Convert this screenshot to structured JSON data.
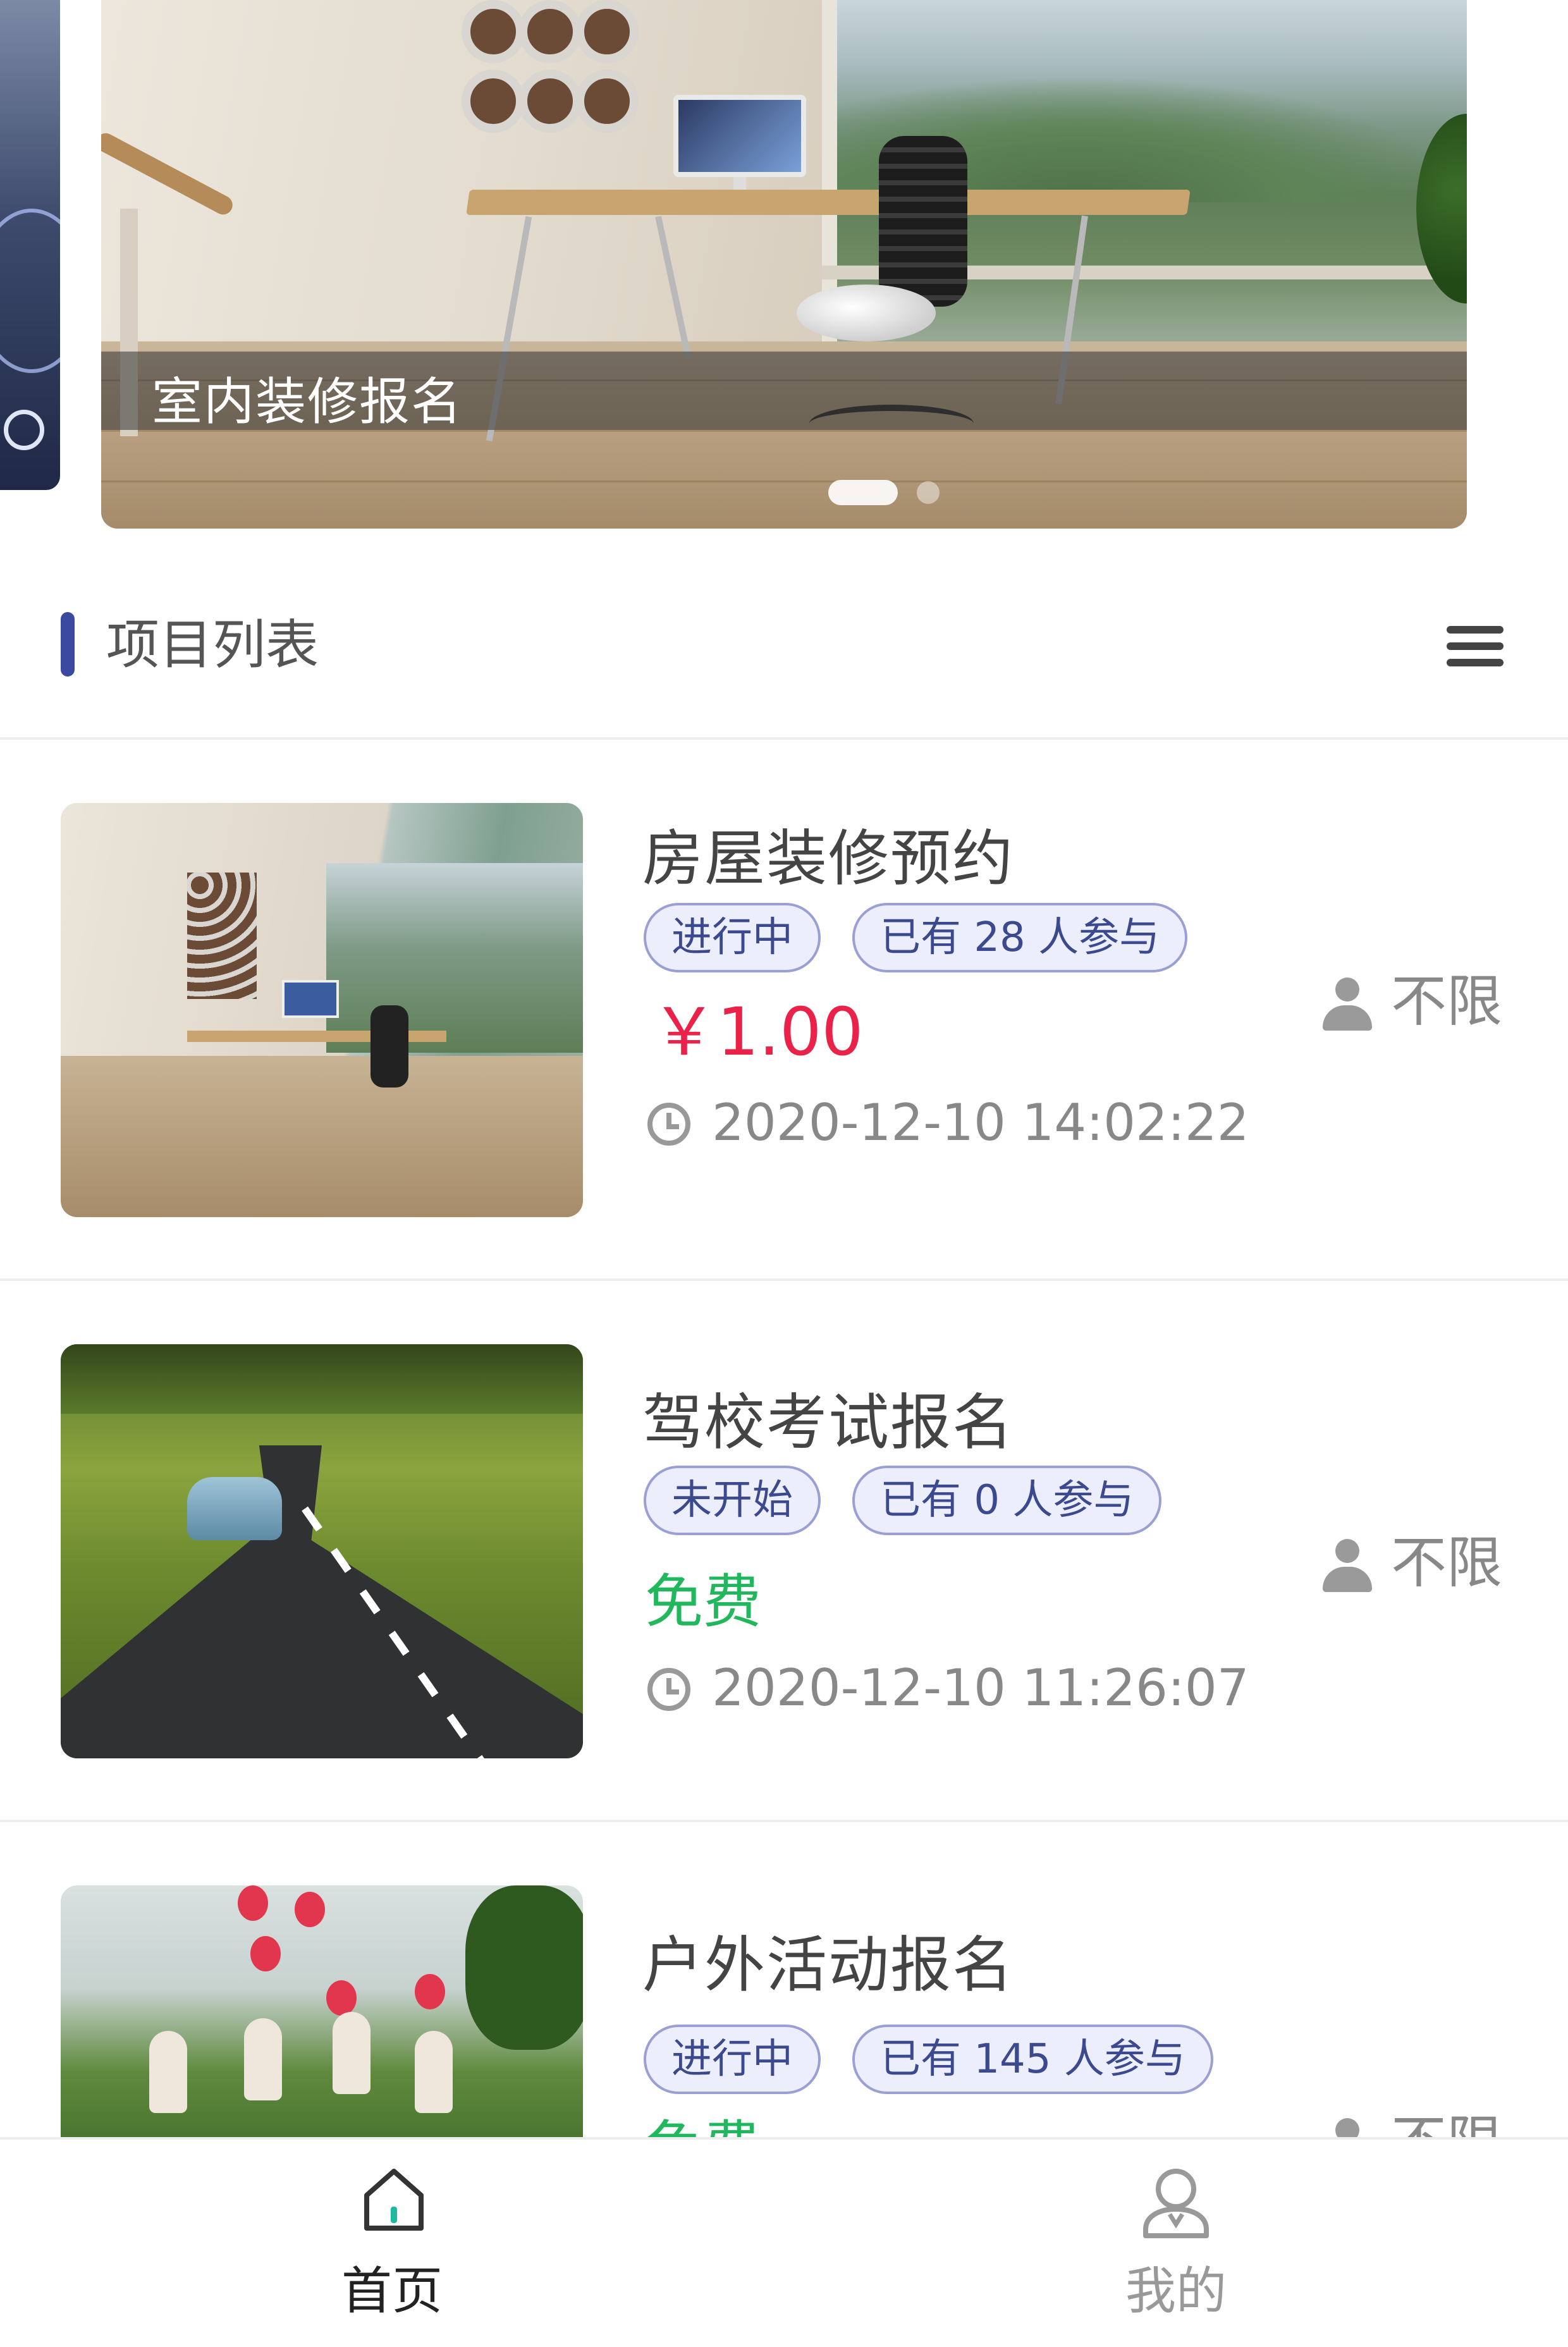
{
  "banner": {
    "caption": "室内装修报名",
    "slide_count": 2,
    "active_slide": 1
  },
  "section": {
    "title": "项目列表",
    "accent_color": "#3b4aa0",
    "menu_icon": "menu-icon"
  },
  "projects": [
    {
      "title": "房屋装修预约",
      "status": "进行中",
      "participants": "已有 28 人参与",
      "price": "￥1.00",
      "price_type": "paid",
      "time": "2020-12-10 14:02:22",
      "limit": "不限",
      "thumb": "room-interior"
    },
    {
      "title": "驾校考试报名",
      "status": "未开始",
      "participants": "已有 0 人参与",
      "price": "免费",
      "price_type": "free",
      "time": "2020-12-10 11:26:07",
      "limit": "不限",
      "thumb": "country-road"
    },
    {
      "title": "户外活动报名",
      "status": "进行中",
      "participants": "已有 145 人参与",
      "price": "免费",
      "price_type": "free",
      "time": "",
      "limit": "不限",
      "thumb": "outdoor-balloons"
    }
  ],
  "colors": {
    "price_red": "#ea2249",
    "free_green": "#21b85d",
    "tag_border": "#9aa0d4",
    "tag_bg": "#eceefb",
    "tab_active_accent": "#21b8a0"
  },
  "tabbar": {
    "items": [
      {
        "label": "首页",
        "icon": "home-icon",
        "active": true
      },
      {
        "label": "我的",
        "icon": "user-icon",
        "active": false
      }
    ]
  }
}
